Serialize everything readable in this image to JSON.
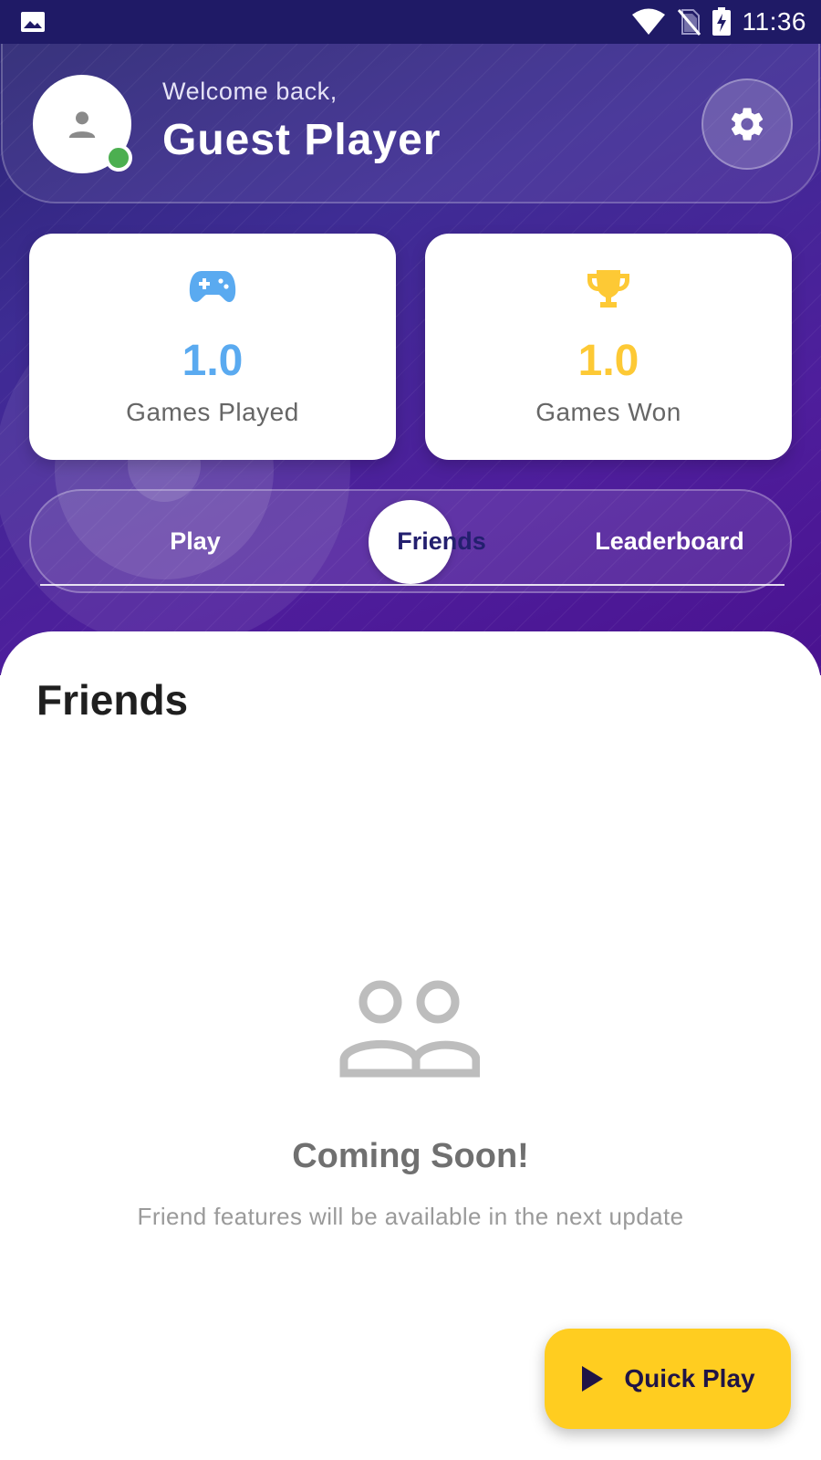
{
  "status_bar": {
    "time": "11:36",
    "icons": [
      "image-icon",
      "wifi-icon",
      "no-sim-icon",
      "battery-charging-icon"
    ]
  },
  "profile": {
    "welcome": "Welcome back,",
    "name": "Guest Player",
    "online": true,
    "avatar_icon": "person-icon",
    "settings_icon": "gear-icon"
  },
  "stats": {
    "played": {
      "value": "1.0",
      "label": "Games Played",
      "icon": "gamepad-icon",
      "color": "#5aaaf0"
    },
    "won": {
      "value": "1.0",
      "label": "Games Won",
      "icon": "trophy-icon",
      "color": "#fdc935"
    }
  },
  "tabs": [
    {
      "label": "Play",
      "active": false
    },
    {
      "label": "Friends",
      "active": true
    },
    {
      "label": "Leaderboard",
      "active": false
    }
  ],
  "content": {
    "title": "Friends",
    "empty_icon": "people-icon",
    "empty_title": "Coming Soon!",
    "empty_subtitle": "Friend features will be available in the next update"
  },
  "fab": {
    "label": "Quick Play",
    "icon": "play-icon",
    "color": "#ffcd20"
  },
  "colors": {
    "header_dark": "#1f1a66",
    "header_purple": "#4e1e9c",
    "online_green": "#4caf50"
  }
}
